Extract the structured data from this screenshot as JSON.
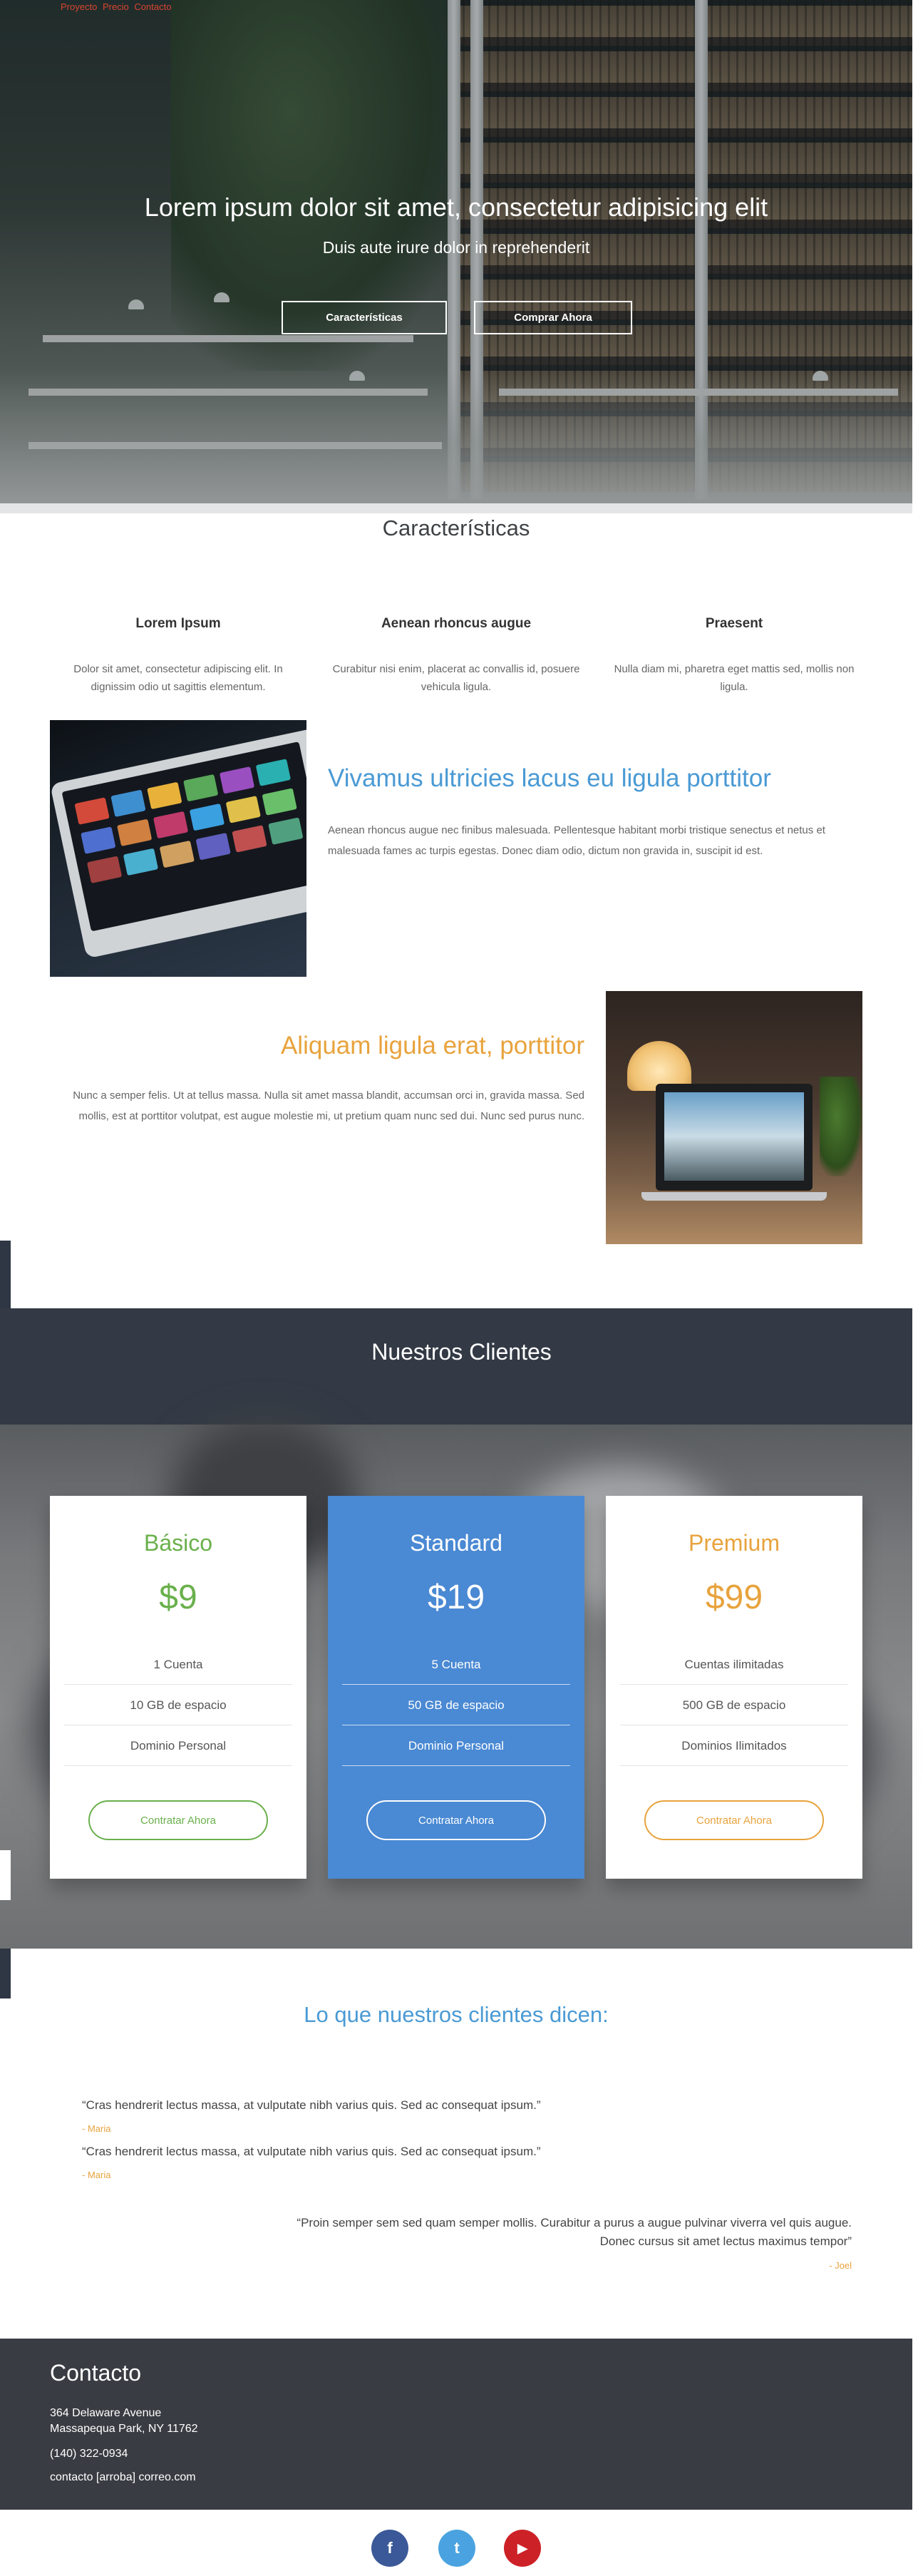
{
  "nav": {
    "links": [
      "Proyecto",
      "Precio",
      "Contacto"
    ]
  },
  "hero": {
    "title": "Lorem ipsum dolor sit amet, consectetur adipisicing elit",
    "subtitle": "Duis aute irure dolor in reprehenderit",
    "btn_features": "Características",
    "btn_buy": "Comprar Ahora"
  },
  "features": {
    "title": "Características",
    "items": [
      {
        "title": "Lorem Ipsum",
        "text": "Dolor sit amet, consectetur adipiscing elit. In dignissim odio ut sagittis elementum."
      },
      {
        "title": "Aenean rhoncus augue",
        "text": "Curabitur nisi enim, placerat ac convallis id, posuere vehicula ligula."
      },
      {
        "title": "Praesent",
        "text": "Nulla diam mi, pharetra eget mattis sed, mollis non ligula."
      }
    ]
  },
  "media": [
    {
      "title": "Vivamus ultricies lacus eu ligula porttitor",
      "text": "Aenean rhoncus augue nec finibus malesuada. Pellentesque habitant morbi tristique senectus et netus et malesuada fames ac turpis egestas. Donec diam odio, dictum non gravida in, suscipit id est.",
      "color": "#4a9ad4"
    },
    {
      "title": "Aliquam ligula erat, porttitor",
      "text": "Nunc a semper felis. Ut at tellus massa. Nulla sit amet massa blandit, accumsan orci in, gravida massa. Sed mollis, est at porttitor volutpat, est augue molestie mi, ut pretium quam nunc sed dui. Nunc sed purus nunc.",
      "color": "#e8a33d"
    }
  ],
  "clients": {
    "title": "Nuestros Clientes"
  },
  "plans": [
    {
      "name": "Básico",
      "price": "$9",
      "features": [
        "1 Cuenta",
        "10 GB de espacio",
        "Dominio Personal"
      ],
      "cta": "Contratar Ahora",
      "accent": "#6ab04c"
    },
    {
      "name": "Standard",
      "price": "$19",
      "features": [
        "5 Cuenta",
        "50 GB de espacio",
        "Dominio Personal"
      ],
      "cta": "Contratar Ahora",
      "accent": "#ffffff"
    },
    {
      "name": "Premium",
      "price": "$99",
      "features": [
        "Cuentas ilimitadas",
        "500 GB de espacio",
        "Dominios Ilimitados"
      ],
      "cta": "Contratar Ahora",
      "accent": "#e8a33d"
    }
  ],
  "testimonials": {
    "title": "Lo que nuestros clientes dicen:",
    "items": [
      {
        "quote": "“Cras hendrerit lectus massa, at vulputate nibh varius quis. Sed ac consequat ipsum.”",
        "author": "- Maria"
      },
      {
        "quote": "“Cras hendrerit lectus massa, at vulputate nibh varius quis. Sed ac consequat ipsum.”",
        "author": "- Maria"
      },
      {
        "quote": "“Proin semper sem sed quam semper mollis. Curabitur a purus a augue pulvinar viverra vel quis augue. Donec cursus sit amet lectus maximus tempor”",
        "author": "- Joel"
      }
    ]
  },
  "contact": {
    "title": "Contacto",
    "address1": "364 Delaware Avenue",
    "address2": "Massapequa Park, NY 11762",
    "phone": "(140) 322-0934",
    "email": "contacto [arroba] correo.com"
  },
  "social": [
    {
      "icon": "facebook-icon",
      "glyph": "f",
      "color": "#3b5998"
    },
    {
      "icon": "twitter-icon",
      "glyph": "t",
      "color": "#4aa3e0"
    },
    {
      "icon": "youtube-icon",
      "glyph": "▶",
      "color": "#cc2127"
    }
  ]
}
